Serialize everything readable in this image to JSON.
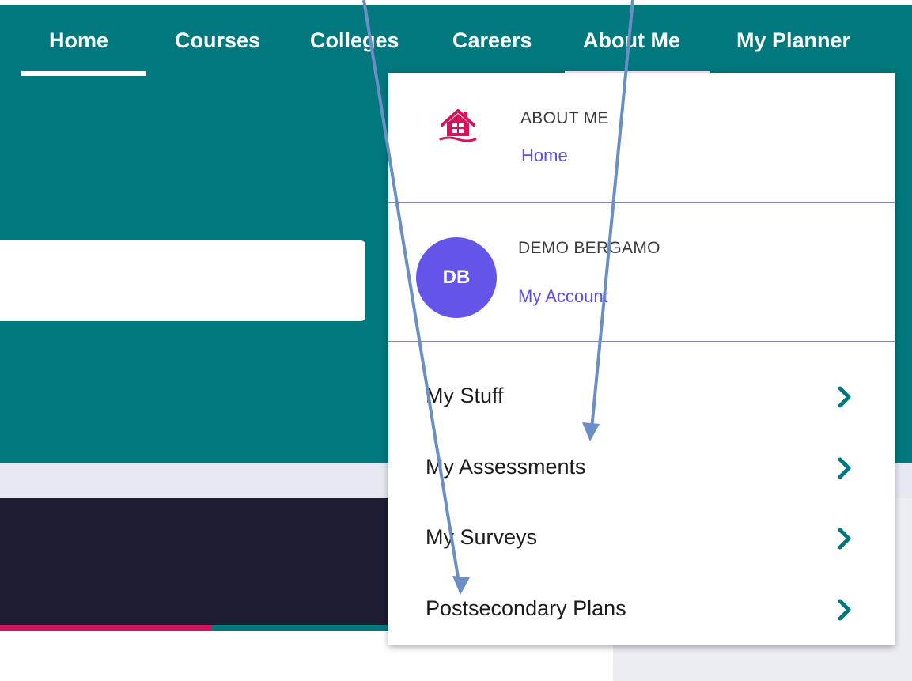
{
  "nav": {
    "items": [
      {
        "label": "Home"
      },
      {
        "label": "Courses"
      },
      {
        "label": "Colleges"
      },
      {
        "label": "Careers"
      },
      {
        "label": "About Me"
      },
      {
        "label": "My Planner"
      }
    ],
    "active": "Home",
    "open_menu": "About Me"
  },
  "dropdown": {
    "about": {
      "title": "ABOUT ME",
      "link": "Home",
      "icon": "house-icon"
    },
    "account": {
      "initials": "DB",
      "name": "DEMO BERGAMO",
      "link": "My Account"
    },
    "menu": [
      {
        "label": "My Stuff"
      },
      {
        "label": "My Assessments"
      },
      {
        "label": "My Surveys"
      },
      {
        "label": "Postsecondary Plans"
      }
    ]
  },
  "search": {
    "value": "",
    "placeholder": ""
  },
  "colors": {
    "teal": "#00787e",
    "accent_pink": "#d4145a",
    "link_purple": "#5b4fe0",
    "avatar_purple": "#6255e8",
    "arrow_blue": "#6b8fc4",
    "dark_navy": "#1d1d33"
  }
}
